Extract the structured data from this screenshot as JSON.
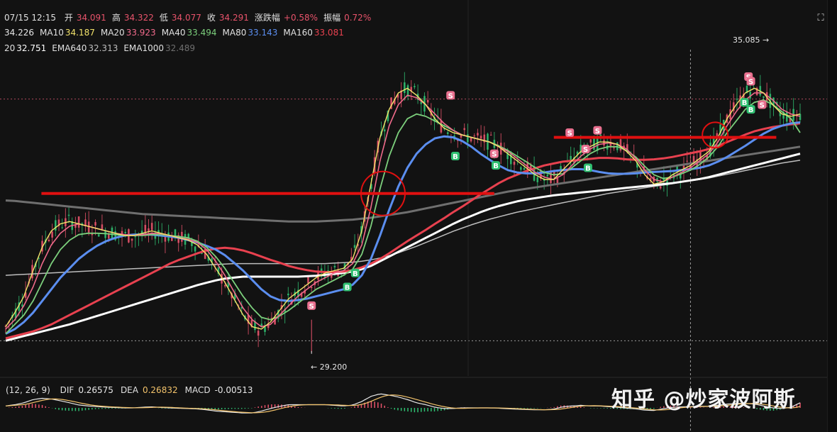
{
  "header": {
    "datetime": "07/15 12:15",
    "ohlc": [
      {
        "label": "开",
        "value": "34.091"
      },
      {
        "label": "高",
        "value": "34.322"
      },
      {
        "label": "低",
        "value": "34.077"
      },
      {
        "label": "收",
        "value": "34.291"
      },
      {
        "label": "涨跌幅",
        "value": "+0.58%"
      },
      {
        "label": "振幅",
        "value": "0.72%"
      }
    ]
  },
  "ma_legend": [
    {
      "label": "",
      "value": "34.226",
      "color": "#e8e8e8"
    },
    {
      "label": "MA10",
      "value": "34.187",
      "color": "#f3e36b"
    },
    {
      "label": "MA20",
      "value": "33.923",
      "color": "#f06a8b"
    },
    {
      "label": "MA40",
      "value": "33.494",
      "color": "#7ccf7c"
    },
    {
      "label": "MA80",
      "value": "33.143",
      "color": "#5b8ef0"
    },
    {
      "label": "MA160",
      "value": "33.081",
      "color": "#e8414f"
    }
  ],
  "ema_legend": [
    {
      "label": "20",
      "value": "32.751",
      "color": "#ffffff"
    },
    {
      "label": "EMA640",
      "value": "32.313",
      "color": "#bdbdbd"
    },
    {
      "label": "EMA1000",
      "value": "32.489",
      "color": "#6f6f6f"
    }
  ],
  "macd_legend": {
    "params": "(12, 26, 9)",
    "items": [
      {
        "label": "DIF",
        "value": "0.26575",
        "color": "#e8e8e8"
      },
      {
        "label": "DEA",
        "value": "0.26832",
        "color": "#f3c36b"
      },
      {
        "label": "MACD",
        "value": "-0.00513",
        "color": "#e8e8e8"
      }
    ]
  },
  "annotations": {
    "high_label": "35.085 →",
    "low_label": "← 29.200"
  },
  "watermark": "知乎 @炒家波阿斯",
  "fullscreen_icon": "expand-icon",
  "colors": {
    "background": "#121212",
    "up": "#e8536b",
    "down": "#2fbf71",
    "resistance": "#e01010",
    "sell_badge": "#e8708f",
    "buy_badge": "#2fbf71"
  },
  "chart_data": {
    "type": "line",
    "price_range": [
      29.0,
      35.6
    ],
    "x_count": 240,
    "series": [
      {
        "name": "MA10",
        "color": "#f3e36b",
        "values": [
          29.75,
          30.05,
          30.4,
          30.95,
          31.45,
          31.8,
          31.95,
          32.0,
          31.95,
          31.9,
          31.85,
          31.8,
          31.75,
          31.7,
          31.7,
          31.75,
          31.8,
          31.75,
          31.7,
          31.65,
          31.6,
          31.5,
          31.3,
          31.0,
          30.7,
          30.35,
          30.0,
          29.75,
          29.7,
          29.85,
          30.1,
          30.35,
          30.5,
          30.65,
          30.8,
          30.9,
          30.95,
          31.0,
          31.2,
          31.8,
          32.8,
          33.8,
          34.4,
          34.75,
          34.85,
          34.7,
          34.5,
          34.2,
          34.0,
          33.9,
          33.85,
          33.8,
          33.75,
          33.7,
          33.6,
          33.45,
          33.3,
          33.15,
          33.0,
          32.9,
          32.9,
          33.1,
          33.3,
          33.5,
          33.6,
          33.7,
          33.7,
          33.65,
          33.5,
          33.3,
          33.0,
          32.8,
          32.85,
          33.0,
          33.1,
          33.2,
          33.35,
          33.5,
          33.8,
          34.2,
          34.5,
          34.75,
          34.85,
          34.75,
          34.5,
          34.3,
          34.25,
          34.3,
          34.3
        ]
      },
      {
        "name": "MA20",
        "color": "#f06a8b",
        "values": [
          29.7,
          29.9,
          30.2,
          30.6,
          31.1,
          31.5,
          31.75,
          31.9,
          31.95,
          31.9,
          31.85,
          31.8,
          31.75,
          31.72,
          31.7,
          31.72,
          31.75,
          31.74,
          31.7,
          31.65,
          31.62,
          31.55,
          31.4,
          31.15,
          30.85,
          30.5,
          30.15,
          29.9,
          29.75,
          29.8,
          30.0,
          30.2,
          30.4,
          30.55,
          30.7,
          30.8,
          30.9,
          30.95,
          31.1,
          31.5,
          32.3,
          33.3,
          34.05,
          34.5,
          34.7,
          34.65,
          34.5,
          34.3,
          34.1,
          33.95,
          33.85,
          33.8,
          33.75,
          33.7,
          33.6,
          33.5,
          33.35,
          33.2,
          33.05,
          32.95,
          32.9,
          33.0,
          33.2,
          33.4,
          33.55,
          33.65,
          33.68,
          33.65,
          33.55,
          33.35,
          33.1,
          32.9,
          32.85,
          32.95,
          33.05,
          33.15,
          33.3,
          33.45,
          33.7,
          34.05,
          34.35,
          34.6,
          34.75,
          34.75,
          34.6,
          34.4,
          34.3,
          34.25,
          33.92
        ]
      },
      {
        "name": "MA40",
        "color": "#7ccf7c",
        "values": [
          29.6,
          29.8,
          30.0,
          30.3,
          30.7,
          31.1,
          31.4,
          31.6,
          31.72,
          31.75,
          31.75,
          31.74,
          31.72,
          31.7,
          31.7,
          31.7,
          31.72,
          31.72,
          31.7,
          31.68,
          31.65,
          31.58,
          31.45,
          31.25,
          31.0,
          30.7,
          30.4,
          30.15,
          29.95,
          29.9,
          29.98,
          30.1,
          30.25,
          30.4,
          30.55,
          30.65,
          30.75,
          30.85,
          30.98,
          31.3,
          31.9,
          32.7,
          33.4,
          33.9,
          34.2,
          34.3,
          34.25,
          34.15,
          34.05,
          33.95,
          33.85,
          33.8,
          33.75,
          33.7,
          33.62,
          33.52,
          33.4,
          33.28,
          33.15,
          33.05,
          33.0,
          33.02,
          33.15,
          33.3,
          33.45,
          33.55,
          33.6,
          33.6,
          33.52,
          33.38,
          33.18,
          33.0,
          32.92,
          32.95,
          33.02,
          33.1,
          33.22,
          33.38,
          33.6,
          33.9,
          34.15,
          34.4,
          34.55,
          34.6,
          34.5,
          34.35,
          34.2,
          33.9,
          33.49
        ]
      },
      {
        "name": "MA80",
        "color": "#5b8ef0",
        "values": [
          29.6,
          29.7,
          29.85,
          30.05,
          30.3,
          30.55,
          30.8,
          31.0,
          31.2,
          31.35,
          31.48,
          31.58,
          31.65,
          31.7,
          31.72,
          31.72,
          31.72,
          31.7,
          31.68,
          31.65,
          31.6,
          31.55,
          31.48,
          31.4,
          31.28,
          31.12,
          30.95,
          30.75,
          30.55,
          30.4,
          30.32,
          30.3,
          30.32,
          30.35,
          30.4,
          30.45,
          30.5,
          30.55,
          30.65,
          30.85,
          31.2,
          31.7,
          32.25,
          32.75,
          33.15,
          33.45,
          33.65,
          33.78,
          33.82,
          33.8,
          33.72,
          33.6,
          33.45,
          33.32,
          33.2,
          33.1,
          33.05,
          33.03,
          33.03,
          33.05,
          33.08,
          33.1,
          33.12,
          33.12,
          33.1,
          33.06,
          33.03,
          33.02,
          33.02,
          33.03,
          33.05,
          33.06,
          33.07,
          33.08,
          33.1,
          33.12,
          33.15,
          33.2,
          33.28,
          33.38,
          33.5,
          33.62,
          33.75,
          33.88,
          33.98,
          34.05,
          34.1,
          34.12,
          33.14
        ]
      },
      {
        "name": "MA160",
        "color": "#e8414f",
        "values": [
          29.5,
          29.55,
          29.6,
          29.65,
          29.72,
          29.8,
          29.9,
          30.0,
          30.1,
          30.2,
          30.3,
          30.4,
          30.5,
          30.6,
          30.7,
          30.8,
          30.9,
          31.0,
          31.1,
          31.18,
          31.25,
          31.32,
          31.38,
          31.42,
          31.44,
          31.42,
          31.38,
          31.32,
          31.25,
          31.18,
          31.12,
          31.05,
          31.0,
          30.96,
          30.93,
          30.92,
          30.92,
          30.93,
          30.96,
          31.02,
          31.1,
          31.2,
          31.32,
          31.45,
          31.58,
          31.7,
          31.82,
          31.95,
          32.07,
          32.2,
          32.32,
          32.45,
          32.58,
          32.7,
          32.82,
          32.92,
          33.0,
          33.08,
          33.14,
          33.2,
          33.24,
          33.28,
          33.3,
          33.32,
          33.34,
          33.36,
          33.36,
          33.35,
          33.33,
          33.32,
          33.32,
          33.33,
          33.35,
          33.38,
          33.42,
          33.46,
          33.5,
          33.55,
          33.62,
          33.7,
          33.78,
          33.86,
          33.93,
          33.98,
          34.02,
          34.05,
          34.08,
          34.1,
          33.08
        ]
      },
      {
        "name": "EMA20",
        "color": "#ffffff",
        "values": [
          29.45,
          29.5,
          29.55,
          29.6,
          29.65,
          29.7,
          29.75,
          29.8,
          29.86,
          29.92,
          29.98,
          30.04,
          30.1,
          30.16,
          30.22,
          30.28,
          30.34,
          30.4,
          30.46,
          30.52,
          30.58,
          30.64,
          30.69,
          30.74,
          30.78,
          30.8,
          30.82,
          30.82,
          30.82,
          30.82,
          30.82,
          30.82,
          30.82,
          30.83,
          30.84,
          30.86,
          30.88,
          30.9,
          30.93,
          30.98,
          31.05,
          31.15,
          31.25,
          31.35,
          31.45,
          31.55,
          31.65,
          31.75,
          31.85,
          31.95,
          32.04,
          32.12,
          32.2,
          32.27,
          32.33,
          32.38,
          32.43,
          32.47,
          32.5,
          32.53,
          32.56,
          32.58,
          32.6,
          32.62,
          32.64,
          32.66,
          32.68,
          32.7,
          32.72,
          32.74,
          32.76,
          32.78,
          32.8,
          32.82,
          32.85,
          32.88,
          32.91,
          32.95,
          33.0,
          33.05,
          33.1,
          33.15,
          33.2,
          33.25,
          33.3,
          33.35,
          33.4,
          33.45,
          32.75
        ]
      },
      {
        "name": "EMA640",
        "color": "#bdbdbd",
        "values": [
          30.85,
          30.86,
          30.87,
          30.88,
          30.89,
          30.9,
          30.91,
          30.92,
          30.93,
          30.94,
          30.95,
          30.96,
          30.97,
          30.98,
          30.99,
          31.0,
          31.01,
          31.02,
          31.03,
          31.04,
          31.05,
          31.06,
          31.07,
          31.08,
          31.09,
          31.1,
          31.1,
          31.1,
          31.1,
          31.1,
          31.1,
          31.1,
          31.1,
          31.1,
          31.1,
          31.1,
          31.11,
          31.12,
          31.13,
          31.15,
          31.18,
          31.22,
          31.27,
          31.33,
          31.4,
          31.47,
          31.55,
          31.63,
          31.71,
          31.79,
          31.86,
          31.93,
          31.99,
          32.05,
          32.1,
          32.15,
          32.2,
          32.24,
          32.28,
          32.32,
          32.36,
          32.4,
          32.44,
          32.48,
          32.52,
          32.56,
          32.6,
          32.63,
          32.66,
          32.69,
          32.72,
          32.75,
          32.78,
          32.81,
          32.84,
          32.87,
          32.9,
          32.93,
          32.97,
          33.01,
          33.05,
          33.09,
          33.13,
          33.17,
          33.21,
          33.25,
          33.28,
          33.31,
          32.31
        ]
      },
      {
        "name": "EMA1000",
        "color": "#6f6f6f",
        "values": [
          32.45,
          32.44,
          32.42,
          32.4,
          32.38,
          32.36,
          32.34,
          32.32,
          32.3,
          32.28,
          32.26,
          32.24,
          32.22,
          32.2,
          32.18,
          32.16,
          32.15,
          32.14,
          32.13,
          32.12,
          32.11,
          32.1,
          32.09,
          32.08,
          32.07,
          32.06,
          32.05,
          32.04,
          32.03,
          32.02,
          32.01,
          32.0,
          32.0,
          32.0,
          32.0,
          32.01,
          32.02,
          32.03,
          32.04,
          32.06,
          32.08,
          32.11,
          32.14,
          32.17,
          32.2,
          32.24,
          32.28,
          32.32,
          32.36,
          32.4,
          32.44,
          32.48,
          32.52,
          32.56,
          32.6,
          32.64,
          32.67,
          32.7,
          32.73,
          32.76,
          32.79,
          32.82,
          32.85,
          32.88,
          32.91,
          32.94,
          32.97,
          33.0,
          33.03,
          33.06,
          33.09,
          33.12,
          33.15,
          33.18,
          33.21,
          33.24,
          33.27,
          33.3,
          33.33,
          33.36,
          33.39,
          33.42,
          33.45,
          33.48,
          33.51,
          33.54,
          33.57,
          33.6,
          32.49
        ]
      }
    ],
    "levels": [
      {
        "name": "resistance-1",
        "value": 32.6,
        "x_from": 0.045,
        "x_to": 0.615
      },
      {
        "name": "resistance-2",
        "value": 33.8,
        "x_from": 0.69,
        "x_to": 0.97
      }
    ],
    "extremes": {
      "high": 35.085,
      "low": 29.2
    },
    "signals": [
      {
        "type": "S",
        "i": 0.385,
        "p": 30.2
      },
      {
        "type": "B",
        "i": 0.44,
        "p": 30.9
      },
      {
        "type": "B",
        "i": 0.43,
        "p": 30.6
      },
      {
        "type": "S",
        "i": 0.56,
        "p": 34.7
      },
      {
        "type": "B",
        "i": 0.566,
        "p": 33.4
      },
      {
        "type": "S",
        "i": 0.615,
        "p": 33.45
      },
      {
        "type": "B",
        "i": 0.617,
        "p": 33.2
      },
      {
        "type": "S",
        "i": 0.71,
        "p": 33.9
      },
      {
        "type": "S",
        "i": 0.73,
        "p": 33.55
      },
      {
        "type": "S",
        "i": 0.745,
        "p": 33.95
      },
      {
        "type": "B",
        "i": 0.733,
        "p": 33.15
      },
      {
        "type": "S",
        "i": 0.935,
        "p": 35.1
      },
      {
        "type": "S",
        "i": 0.938,
        "p": 35.0
      },
      {
        "type": "B",
        "i": 0.93,
        "p": 34.55
      },
      {
        "type": "B",
        "i": 0.938,
        "p": 34.4
      },
      {
        "type": "S",
        "i": 0.952,
        "p": 34.5
      }
    ],
    "circles": [
      {
        "i": 0.475,
        "p": 32.6
      },
      {
        "i": 0.893,
        "p": 33.85
      }
    ],
    "gridlines": {
      "dotted_price": [
        34.62,
        29.45
      ],
      "dotted_time": 0.862
    }
  }
}
